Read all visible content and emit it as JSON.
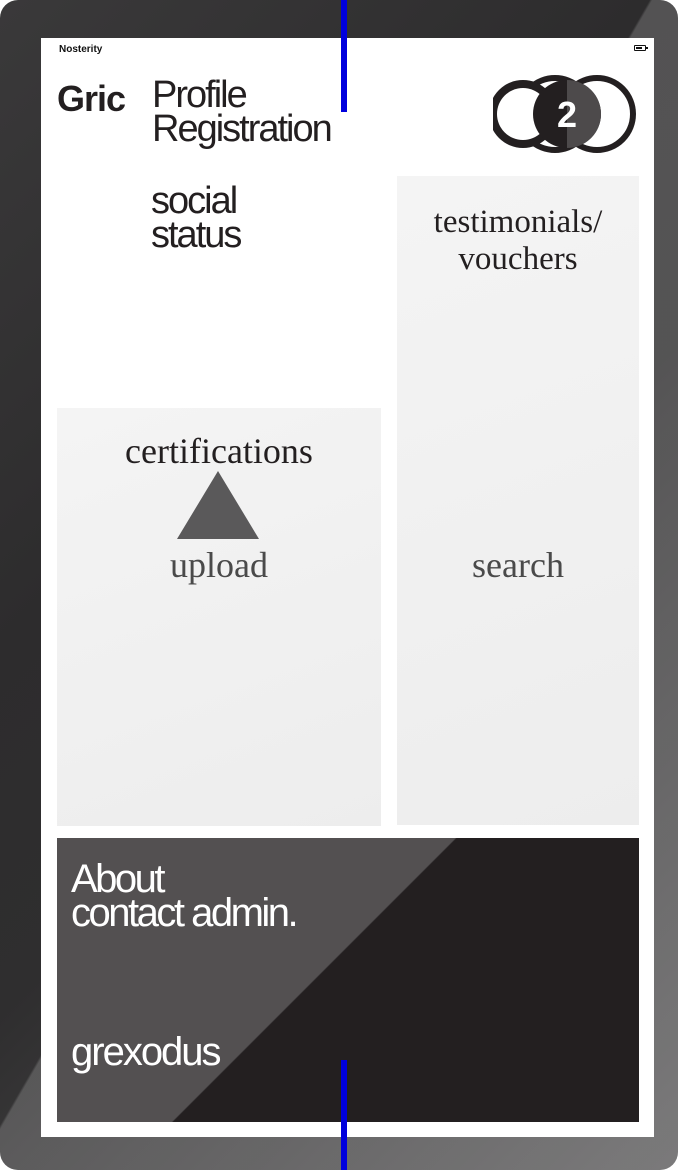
{
  "status_bar": {
    "carrier": "Nosterity",
    "battery_icon": "battery-icon"
  },
  "header": {
    "brand": "Gric",
    "title_line1": "Profile",
    "title_line2": "Registration",
    "badge_number": "2",
    "badge_icon": "overlapping-circles-icon"
  },
  "sections": {
    "social_line1": "social",
    "social_line2": "status",
    "testimonials_line1": "testimonials/",
    "testimonials_line2": "vouchers",
    "search": "search",
    "certifications": "certifications",
    "upload": "upload",
    "upload_icon": "triangle-up-icon"
  },
  "footer": {
    "about": "About",
    "contact": "contact admin.",
    "brand": "grexodus"
  },
  "colors": {
    "dark": "#231f20",
    "tile": "#f0f0f0",
    "marker": "#0000dd"
  }
}
